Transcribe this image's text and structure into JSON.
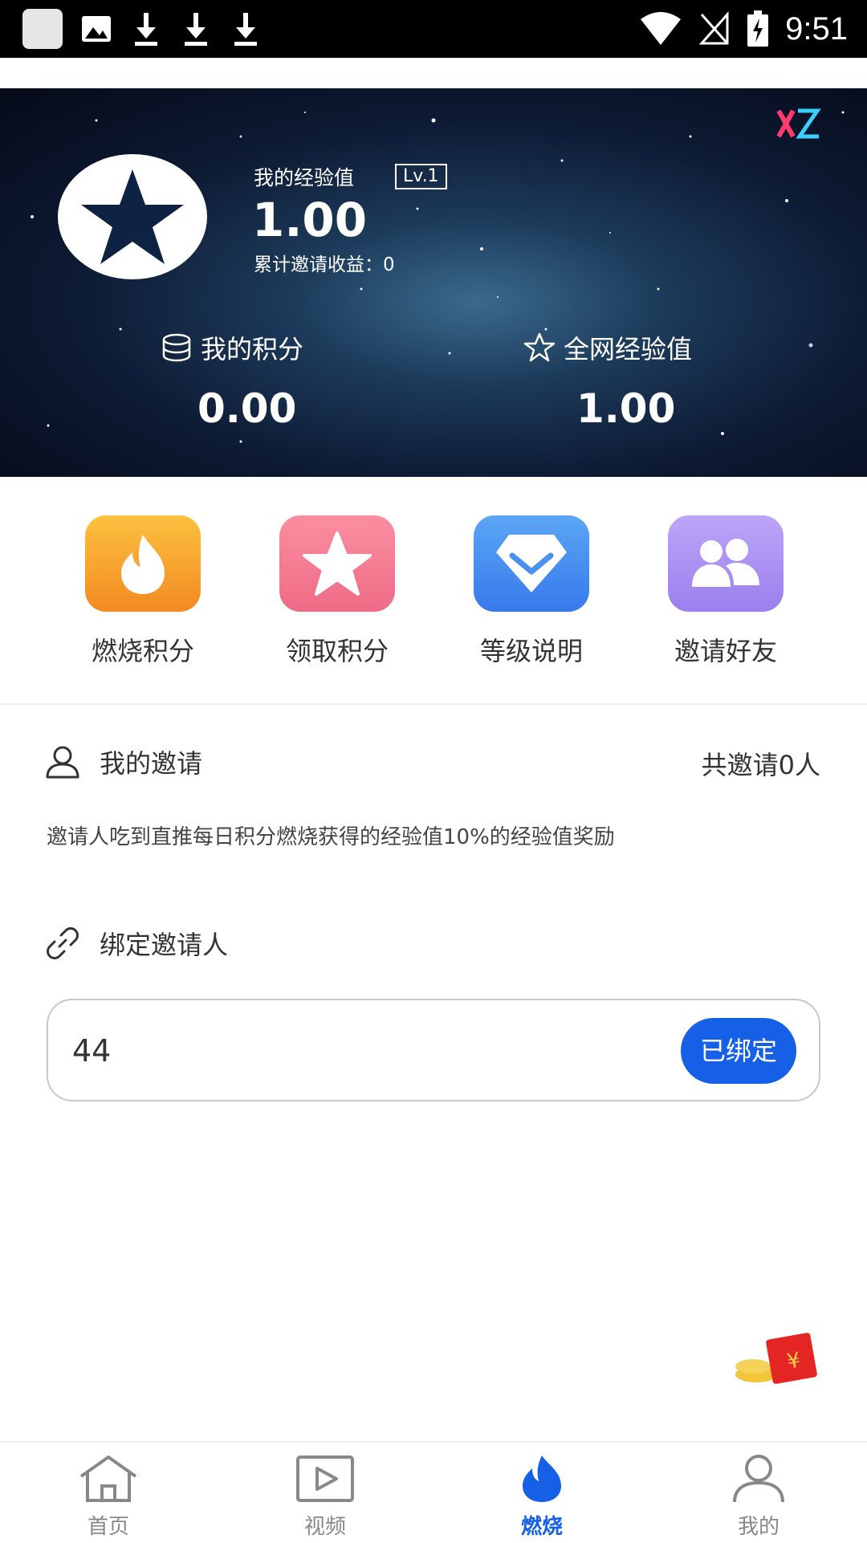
{
  "status_bar": {
    "time": "9:51"
  },
  "hero": {
    "exp_label": "我的经验值",
    "level": "Lv.1",
    "exp_value": "1.00",
    "invite_earnings": "累计邀请收益：0",
    "points_label": "我的积分",
    "points_value": "0.00",
    "network_exp_label": "全网经验值",
    "network_exp_value": "1.00"
  },
  "actions": [
    {
      "label": "燃烧积分",
      "icon": "flame-icon",
      "color": "#f7a72e"
    },
    {
      "label": "领取积分",
      "icon": "star-icon",
      "color": "#f27a92"
    },
    {
      "label": "等级说明",
      "icon": "diamond-icon",
      "color": "#3f8ff0"
    },
    {
      "label": "邀请好友",
      "icon": "users-icon",
      "color": "#a98cf0"
    }
  ],
  "invite": {
    "title": "我的邀请",
    "count": "共邀请0人",
    "description": "邀请人吃到直推每日积分燃烧获得的经验值10%的经验值奖励"
  },
  "bind": {
    "title": "绑定邀请人",
    "value": "44",
    "button_label": "已绑定"
  },
  "nav": [
    {
      "label": "首页",
      "icon": "home-icon"
    },
    {
      "label": "视频",
      "icon": "video-icon"
    },
    {
      "label": "燃烧",
      "icon": "flame-icon",
      "active": true
    },
    {
      "label": "我的",
      "icon": "profile-icon"
    }
  ],
  "colors": {
    "accent": "#1560e6"
  }
}
